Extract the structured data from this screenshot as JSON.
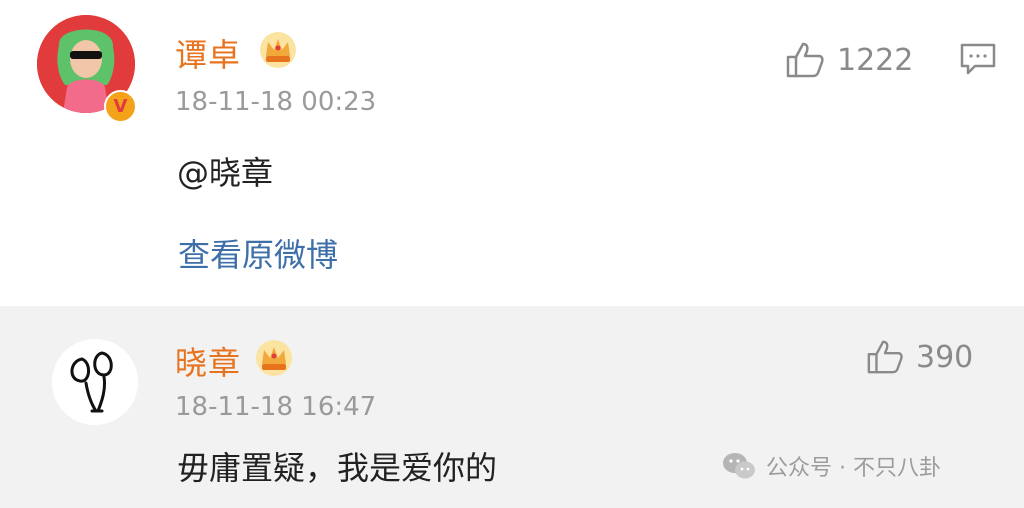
{
  "comment1": {
    "username": "谭卓",
    "timestamp": "18-11-18 00:23",
    "content": "@晓章",
    "link": "查看原微博",
    "likes": "1222",
    "verified_badge": "V"
  },
  "comment2": {
    "username": "晓章",
    "timestamp": "18-11-18 16:47",
    "content": "毋庸置疑，我是爱你的",
    "likes": "390"
  },
  "watermark": {
    "text": "公众号 · 不只八卦"
  },
  "colors": {
    "username": "#e8731e",
    "link": "#3e6fa8",
    "timestamp": "#9a9a9a",
    "reply_bg": "#f2f2f2"
  }
}
